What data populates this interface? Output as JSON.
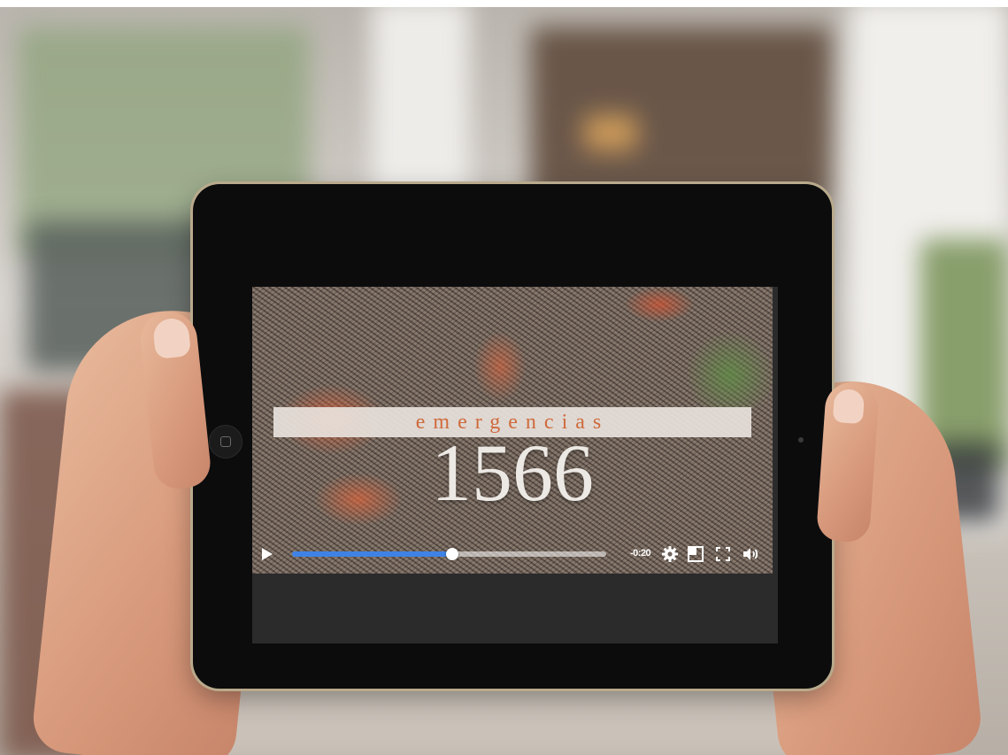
{
  "video": {
    "title_word": "emergencias",
    "title_number": "1566",
    "progress": 0.51
  },
  "controls": {
    "time_remaining": "-0:20",
    "icons": [
      "play-icon",
      "settings-icon",
      "popout-icon",
      "fullscreen-icon",
      "volume-icon"
    ],
    "accent_color": "#3f82e6"
  }
}
